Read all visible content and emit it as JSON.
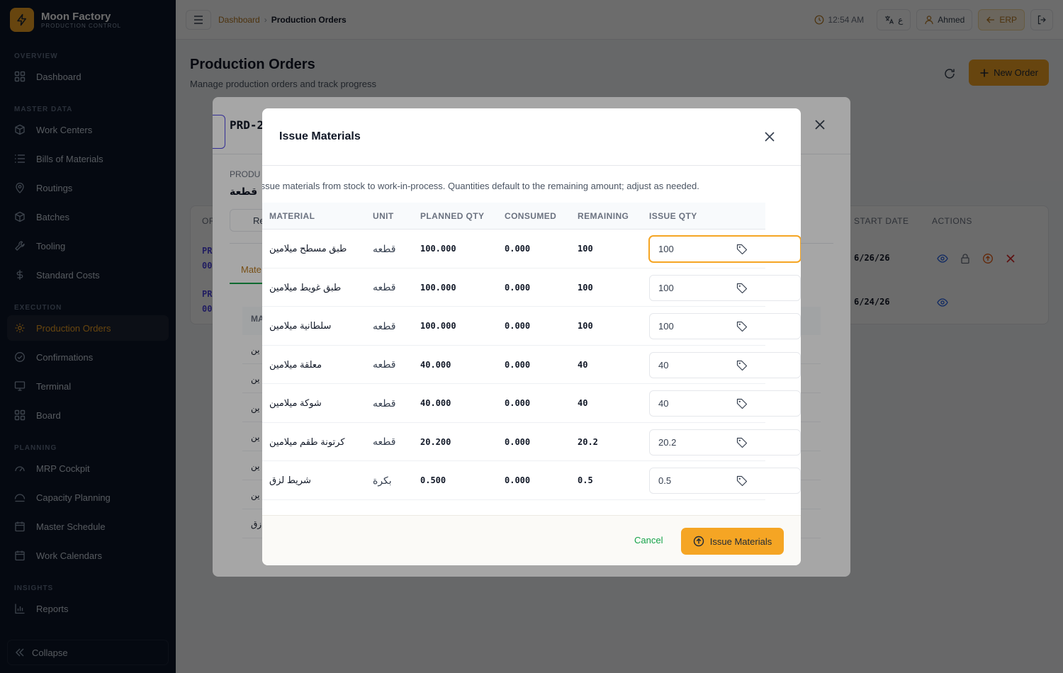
{
  "brand": {
    "name": "Moon Factory",
    "subtitle": "PRODUCTION CONTROL"
  },
  "sidebar": {
    "sections": [
      {
        "label": "OVERVIEW",
        "items": [
          {
            "label": "Dashboard",
            "icon": "grid-icon"
          }
        ]
      },
      {
        "label": "MASTER DATA",
        "items": [
          {
            "label": "Work Centers",
            "icon": "cube-icon"
          },
          {
            "label": "Bills of Materials",
            "icon": "list-icon"
          },
          {
            "label": "Routings",
            "icon": "route-icon"
          },
          {
            "label": "Batches",
            "icon": "box-icon"
          },
          {
            "label": "Tooling",
            "icon": "wrench-icon"
          },
          {
            "label": "Standard Costs",
            "icon": "dollar-icon"
          }
        ]
      },
      {
        "label": "EXECUTION",
        "items": [
          {
            "label": "Production Orders",
            "icon": "gear-icon",
            "active": true
          },
          {
            "label": "Confirmations",
            "icon": "check-circle-icon"
          },
          {
            "label": "Terminal",
            "icon": "monitor-icon"
          },
          {
            "label": "Board",
            "icon": "grid-icon"
          }
        ]
      },
      {
        "label": "PLANNING",
        "items": [
          {
            "label": "MRP Cockpit",
            "icon": "gauge-icon"
          },
          {
            "label": "Capacity Planning",
            "icon": "capacity-icon"
          },
          {
            "label": "Master Schedule",
            "icon": "calendar-icon"
          },
          {
            "label": "Work Calendars",
            "icon": "calendar-icon"
          }
        ]
      },
      {
        "label": "INSIGHTS",
        "items": [
          {
            "label": "Reports",
            "icon": "bar-chart-icon"
          }
        ]
      }
    ],
    "collapse_label": "Collapse"
  },
  "topbar": {
    "breadcrumb": [
      "Dashboard",
      "Production Orders"
    ],
    "time": "12:54 AM",
    "lang_label": "ع",
    "user": "Ahmed",
    "erp_label": "ERP"
  },
  "page": {
    "title": "Production Orders",
    "subtitle": "Manage production orders and track progress",
    "new_order_label": "New Order",
    "table": {
      "headers_visible": [
        "START DATE",
        "ACTIONS"
      ],
      "left_header_fragment": "OR",
      "rows": [
        {
          "id_fragment": "PR",
          "id_fragment_2": "00",
          "start_date": "6/26/26"
        },
        {
          "id_fragment": "PR",
          "id_fragment_2": "00",
          "start_date": "6/24/26"
        }
      ]
    }
  },
  "back_modal": {
    "title_fragment": "PRD-2",
    "label_fragment": "PRODU",
    "value_fragment": "قطعة",
    "button_fragment": "Re",
    "tab_fragment": "Mate",
    "th_fragment": "MA",
    "row_fragments": [
      "ين",
      "ين",
      "ين",
      "ين",
      "ين",
      "ين",
      "زق"
    ]
  },
  "modal": {
    "title": "Issue Materials",
    "description": "Issue materials from stock to work-in-process. Quantities default to the remaining amount; adjust as needed.",
    "headers": [
      "MATERIAL",
      "UNIT",
      "PLANNED QTY",
      "CONSUMED",
      "REMAINING",
      "ISSUE QTY"
    ],
    "rows": [
      {
        "material": "طبق مسطح ميلامين",
        "unit": "قطعه",
        "planned": "100.000",
        "consumed": "0.000",
        "remaining": "100",
        "issue": "100"
      },
      {
        "material": "طبق غويط ميلامين",
        "unit": "قطعه",
        "planned": "100.000",
        "consumed": "0.000",
        "remaining": "100",
        "issue": "100"
      },
      {
        "material": "سلطانية ميلامين",
        "unit": "قطعه",
        "planned": "100.000",
        "consumed": "0.000",
        "remaining": "100",
        "issue": "100"
      },
      {
        "material": "معلقة ميلامين",
        "unit": "قطعه",
        "planned": "40.000",
        "consumed": "0.000",
        "remaining": "40",
        "issue": "40"
      },
      {
        "material": "شوكة ميلامين",
        "unit": "قطعه",
        "planned": "40.000",
        "consumed": "0.000",
        "remaining": "40",
        "issue": "40"
      },
      {
        "material": "كرتونة طقم ميلامين",
        "unit": "قطعه",
        "planned": "20.200",
        "consumed": "0.000",
        "remaining": "20.2",
        "issue": "20.2"
      },
      {
        "material": "شريط لزق",
        "unit": "بكرة",
        "planned": "0.500",
        "consumed": "0.000",
        "remaining": "0.5",
        "issue": "0.5"
      }
    ],
    "cancel_label": "Cancel",
    "submit_label": "Issue Materials"
  },
  "colors": {
    "accent": "#f5a524",
    "sidebar_bg": "#0f172a",
    "link": "#b7791f",
    "cancel": "#16a34a"
  }
}
